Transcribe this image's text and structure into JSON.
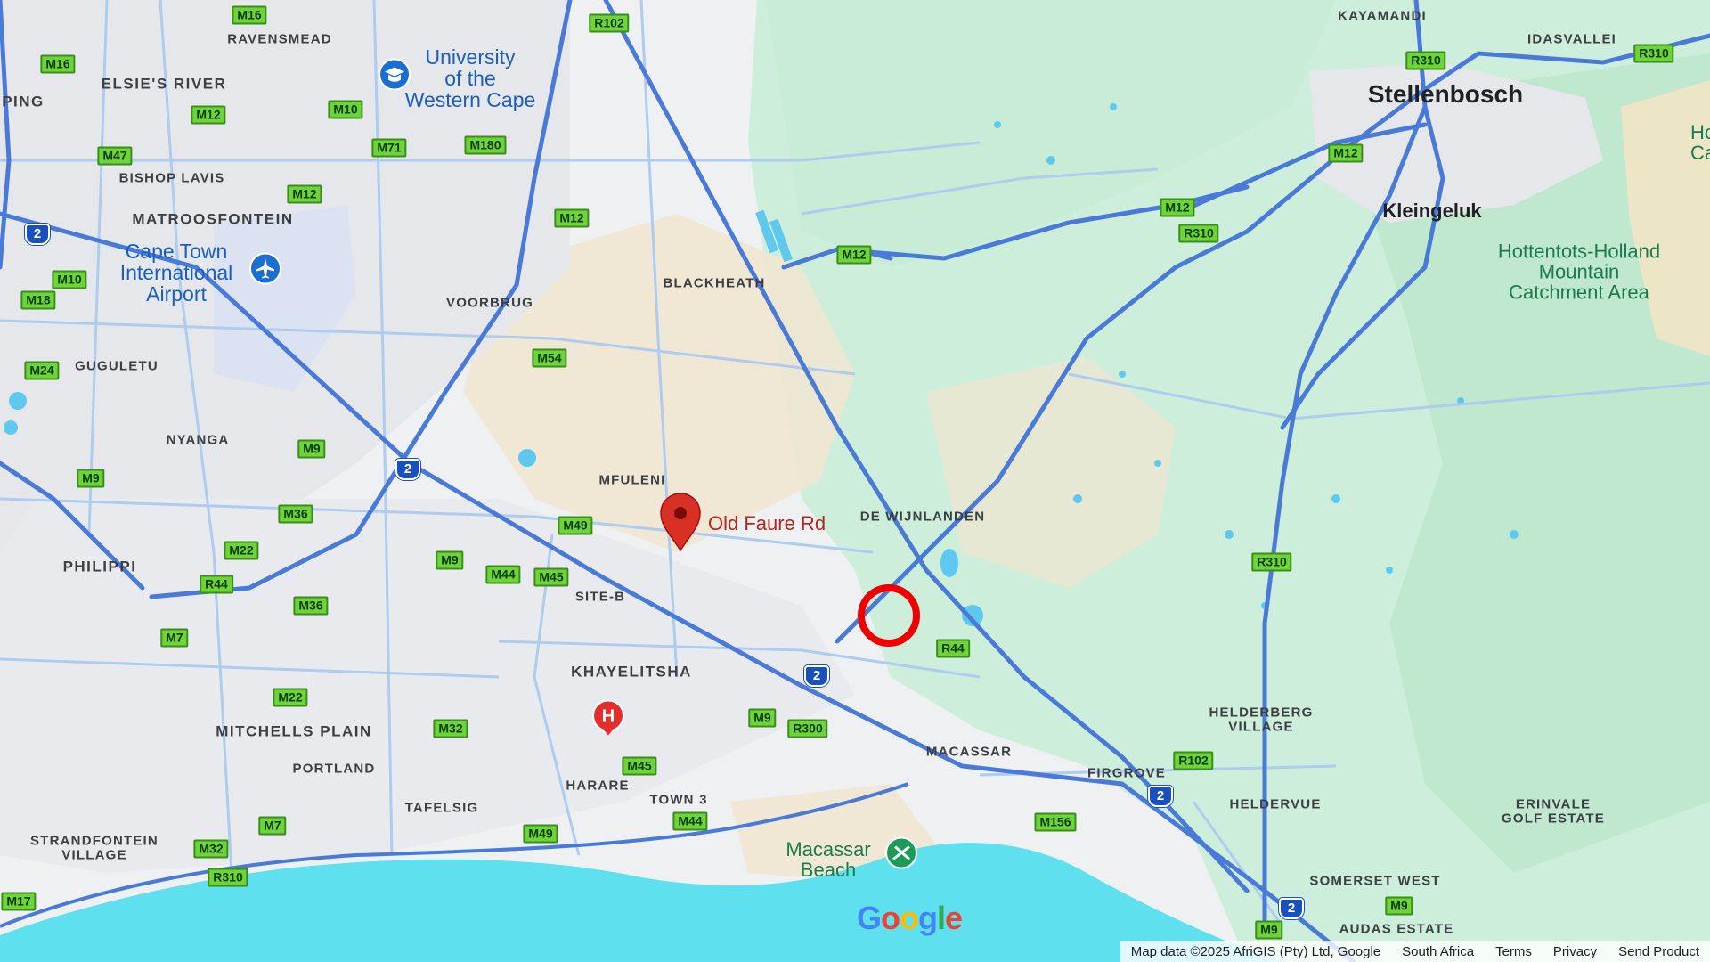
{
  "map": {
    "colors": {
      "land": "#eef0f2",
      "park": "#c6ecd4",
      "water": "#5fe0ee",
      "urban": "#e8e8ea",
      "highway": "#4a7ad8",
      "arterial": "#aecbf0",
      "marker": "#d93025"
    },
    "pin": {
      "label": "Old Faure Rd",
      "icon": "map-pin-icon"
    },
    "highlight_circle": {
      "icon": "circle-marker-icon"
    },
    "towns": [
      {
        "id": "stellenbosch",
        "text": "Stellenbosch"
      },
      {
        "id": "kleingeluk",
        "text": "Kleingeluk"
      }
    ],
    "areas": [
      {
        "id": "kayamandi",
        "text": "KAYAMANDI"
      },
      {
        "id": "idasvallei",
        "text": "IDASVALLEI"
      },
      {
        "id": "ravensmead",
        "text": "RAVENSMEAD"
      },
      {
        "id": "elsies-river",
        "text": "ELSIE'S RIVER"
      },
      {
        "id": "ping",
        "text": "PING"
      },
      {
        "id": "bishop-lavis",
        "text": "BISHOP LAVIS"
      },
      {
        "id": "matroosfontein",
        "text": "MATROOSFONTEIN"
      },
      {
        "id": "blackheath",
        "text": "BLACKHEATH"
      },
      {
        "id": "voorbrug",
        "text": "VOORBRUG"
      },
      {
        "id": "guguletu",
        "text": "GUGULETU"
      },
      {
        "id": "nyanga",
        "text": "NYANGA"
      },
      {
        "id": "mfuleni",
        "text": "MFULENI"
      },
      {
        "id": "de-wijnlanden",
        "text": "DE WIJNLANDEN"
      },
      {
        "id": "philippi",
        "text": "PHILIPPI"
      },
      {
        "id": "site-b",
        "text": "SITE-B"
      },
      {
        "id": "khayelitsha",
        "text": "KHAYELITSHA"
      },
      {
        "id": "mitchells-plain",
        "text": "MITCHELLS PLAIN"
      },
      {
        "id": "portland",
        "text": "PORTLAND"
      },
      {
        "id": "tafelsig",
        "text": "TAFELSIG"
      },
      {
        "id": "harare",
        "text": "HARARE"
      },
      {
        "id": "town-3",
        "text": "TOWN 3"
      },
      {
        "id": "macassar",
        "text": "MACASSAR"
      },
      {
        "id": "helderberg-village",
        "text": "HELDERBERG\nVILLAGE"
      },
      {
        "id": "firgrove",
        "text": "FIRGROVE"
      },
      {
        "id": "heldervue",
        "text": "HELDERVUE"
      },
      {
        "id": "erinvale",
        "text": "ERINVALE\nGOLF ESTATE"
      },
      {
        "id": "somerset-west",
        "text": "SOMERSET WEST"
      },
      {
        "id": "audas-estate",
        "text": "AUDAS ESTATE"
      },
      {
        "id": "strandfontein",
        "text": "STRANDFONTEIN\nVILLAGE"
      }
    ],
    "pois": [
      {
        "id": "uwc",
        "text": "University\nof the\nWestern Cape",
        "icon": "graduation-cap-icon"
      },
      {
        "id": "airport",
        "text": "Cape Town\nInternational\nAirport",
        "icon": "airplane-icon"
      },
      {
        "id": "hottentots",
        "text": "Hottentots-Holland\nMountain\nCatchment Area"
      },
      {
        "id": "hotte-partial",
        "text": "Hotte\nCatc"
      },
      {
        "id": "macassar-beach",
        "text": "Macassar\nBeach",
        "icon": "beach-icon"
      },
      {
        "id": "hospital",
        "text": "",
        "icon": "hospital-icon"
      }
    ],
    "route_shields": [
      "M16",
      "M16",
      "M12",
      "M10",
      "M47",
      "M71",
      "M180",
      "M12",
      "M12",
      "M10",
      "M18",
      "M24",
      "M9",
      "M9",
      "M36",
      "M22",
      "M36",
      "M7",
      "M22",
      "M32",
      "M7",
      "M32",
      "R310",
      "M17",
      "R102",
      "M12",
      "M54",
      "M49",
      "M9",
      "M44",
      "M45",
      "M9",
      "M45",
      "M44",
      "M49",
      "M12",
      "R310",
      "M12",
      "R310",
      "R310",
      "R310",
      "R44",
      "R102",
      "M156",
      "M9",
      "M9",
      "R44",
      "R300",
      "R310"
    ],
    "national_shields": [
      "2",
      "2",
      "2",
      "2",
      "2"
    ],
    "google_logo": "Google",
    "attribution": {
      "map_data": "Map data ©2025 AfriGIS (Pty) Ltd, Google",
      "country": "South Africa",
      "terms": "Terms",
      "privacy": "Privacy",
      "send_feedback": "Send Product"
    }
  }
}
